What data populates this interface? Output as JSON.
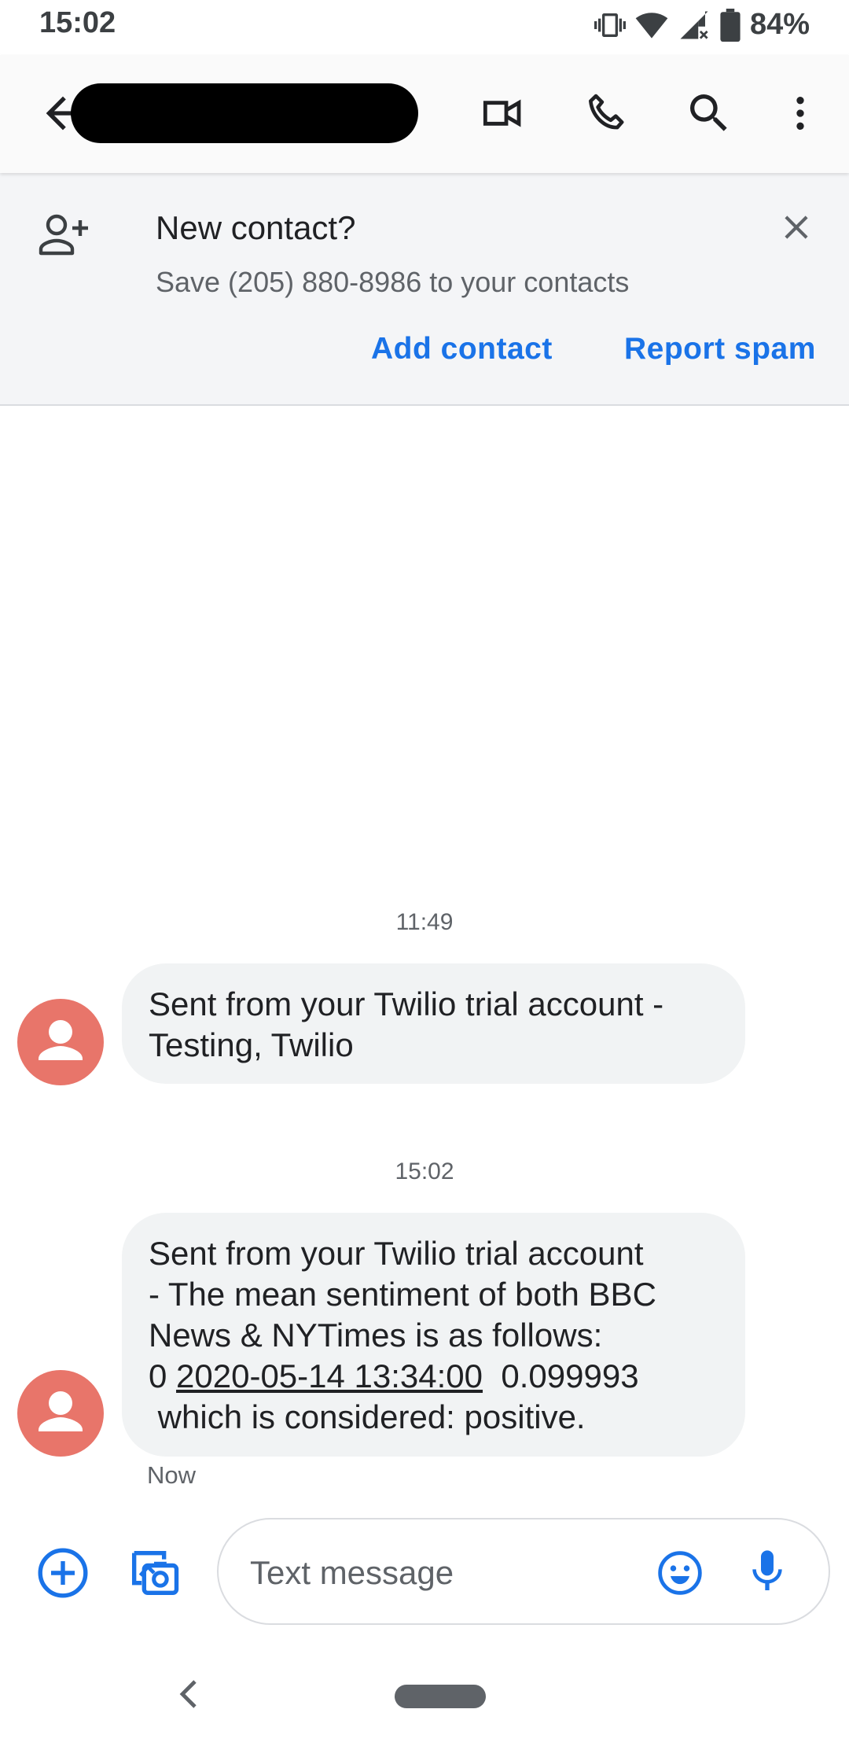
{
  "status_bar": {
    "time": "15:02",
    "battery_percent": "84%",
    "icons": [
      "vibrate-icon",
      "wifi-icon",
      "signal-icon",
      "battery-icon"
    ]
  },
  "app_bar": {
    "contact_name": "",
    "icons": [
      "back-arrow-icon",
      "video-call-icon",
      "phone-icon",
      "search-icon",
      "more-vert-icon"
    ]
  },
  "banner": {
    "title": "New contact?",
    "subtitle": "Save (205) 880-8986 to your contacts",
    "add_contact_label": "Add contact",
    "report_spam_label": "Report spam"
  },
  "messages": [
    {
      "timestamp": "11:49",
      "lines": [
        "Sent from your Twilio trial account -",
        "Testing, Twilio"
      ]
    },
    {
      "timestamp": "15:02",
      "lines": [
        "Sent from your Twilio trial account",
        "- The mean sentiment of both BBC",
        "News & NYTimes is as follows:"
      ],
      "line4_prefix": "0 ",
      "line4_link": "2020-05-14 13:34:00",
      "line4_suffix": "  0.099993",
      "line5": " which is considered: positive.",
      "status": "Now"
    }
  ],
  "compose": {
    "placeholder": "Text message"
  },
  "colors": {
    "accent": "#1a73e8",
    "avatar": "#e8756a",
    "bubble": "#f1f3f4",
    "banner_bg": "#f4f5f7"
  }
}
